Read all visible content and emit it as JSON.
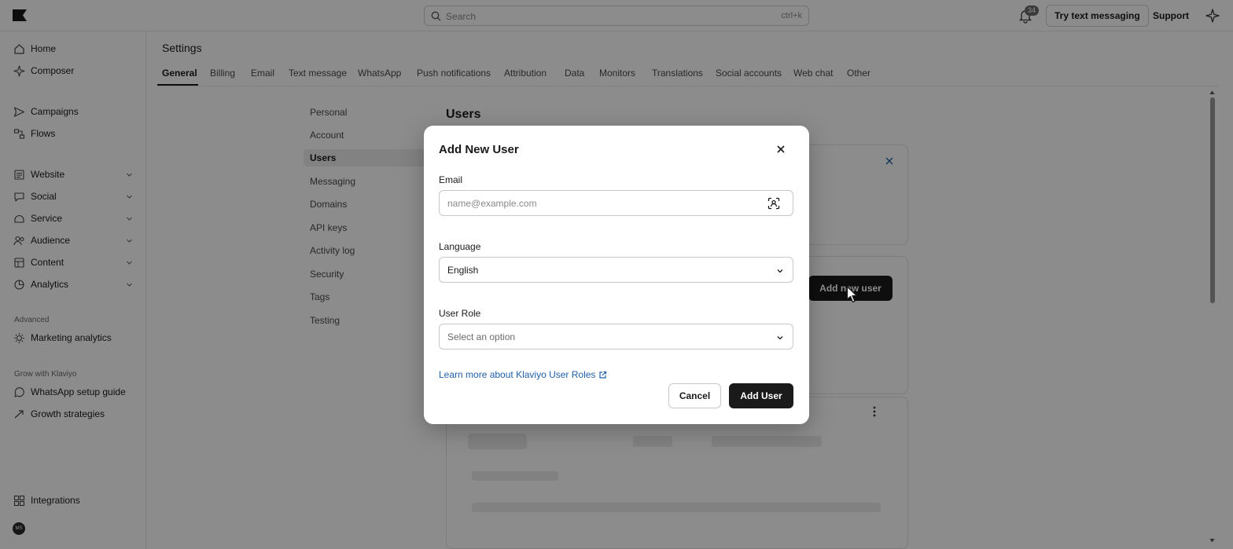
{
  "topbar": {
    "search_placeholder": "Search",
    "search_shortcut": "ctrl+k",
    "notifications_count": "34",
    "try_text_messaging": "Try text messaging",
    "support": "Support"
  },
  "sidebar": {
    "primary": [
      {
        "label": "Home",
        "icon": "home-icon"
      },
      {
        "label": "Composer",
        "icon": "sparkle-icon"
      }
    ],
    "group1": [
      {
        "label": "Campaigns",
        "icon": "send-icon"
      },
      {
        "label": "Flows",
        "icon": "flows-icon"
      }
    ],
    "group2": [
      {
        "label": "Website",
        "icon": "website-icon"
      },
      {
        "label": "Social",
        "icon": "social-icon"
      },
      {
        "label": "Service",
        "icon": "service-icon"
      },
      {
        "label": "Audience",
        "icon": "audience-icon"
      },
      {
        "label": "Content",
        "icon": "content-icon"
      },
      {
        "label": "Analytics",
        "icon": "analytics-icon"
      }
    ],
    "advanced_label": "Advanced",
    "advanced": [
      {
        "label": "Marketing analytics",
        "icon": "bulb-icon"
      }
    ],
    "grow_label": "Grow with Klaviyo",
    "grow": [
      {
        "label": "WhatsApp setup guide",
        "icon": "whatsapp-icon"
      },
      {
        "label": "Growth strategies",
        "icon": "trend-icon"
      }
    ],
    "integrations": "Integrations",
    "avatar_initials": "MS"
  },
  "settings": {
    "title": "Settings",
    "tabs": [
      "General",
      "Billing",
      "Email",
      "Text message",
      "WhatsApp",
      "Push notifications",
      "Attribution",
      "Data",
      "Monitors",
      "Translations",
      "Social accounts",
      "Web chat",
      "Other"
    ],
    "active_tab": "General",
    "subnav": [
      "Personal",
      "Account",
      "Users",
      "Messaging",
      "Domains",
      "API keys",
      "Activity log",
      "Security",
      "Tags",
      "Testing"
    ],
    "active_subnav": "Users",
    "section_title": "Users",
    "add_new_user_label": "Add new user"
  },
  "modal": {
    "title": "Add New User",
    "email_label": "Email",
    "email_placeholder": "name@example.com",
    "language_label": "Language",
    "language_value": "English",
    "role_label": "User Role",
    "role_placeholder": "Select an option",
    "learn_more": "Learn more about Klaviyo User Roles",
    "cancel": "Cancel",
    "add_user": "Add User"
  },
  "colors": {
    "accent": "#1a1a1a",
    "link": "#1f5fa8",
    "overlay": "rgba(0,0,0,0.45)"
  }
}
